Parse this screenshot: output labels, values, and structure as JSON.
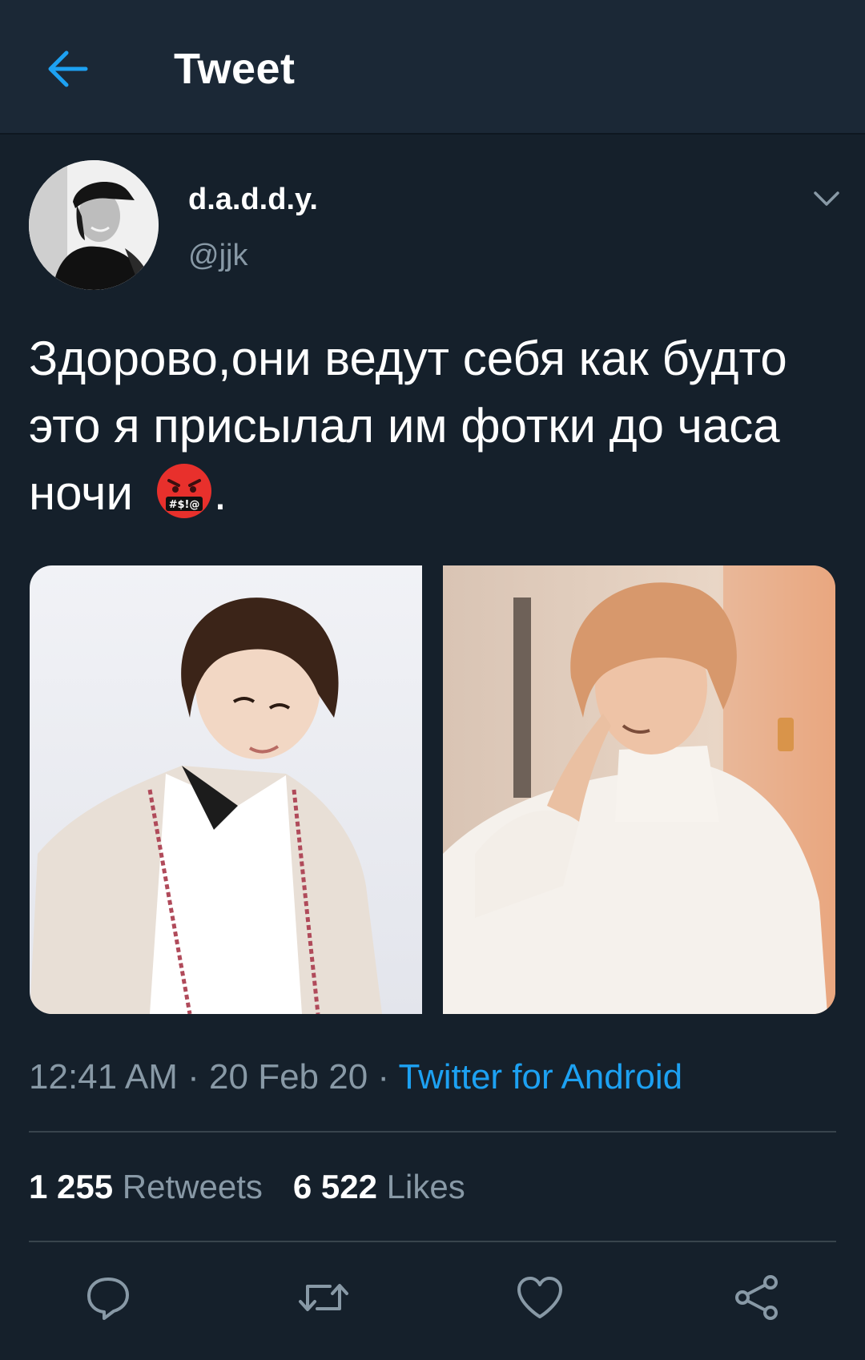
{
  "header": {
    "title": "Tweet",
    "back_icon": "arrow-left-icon",
    "accent_color": "#1da1f2"
  },
  "tweet": {
    "display_name": "d.a.d.d.y.",
    "handle": "@jjk",
    "text": "Здорово,они ведут себя как будто это я присылал им фотки до часа ночи",
    "text_suffix": ".",
    "emoji": "face-with-symbols-on-mouth",
    "time": "12:41 AM",
    "date": "20 Feb 20",
    "separator": "·",
    "client": "Twitter for Android",
    "media_count": 2
  },
  "stats": {
    "retweets_count": "1 255",
    "retweets_label": "Retweets",
    "likes_count": "6 522",
    "likes_label": "Likes"
  },
  "actions": [
    "reply-icon",
    "retweet-icon",
    "like-icon",
    "share-icon"
  ]
}
